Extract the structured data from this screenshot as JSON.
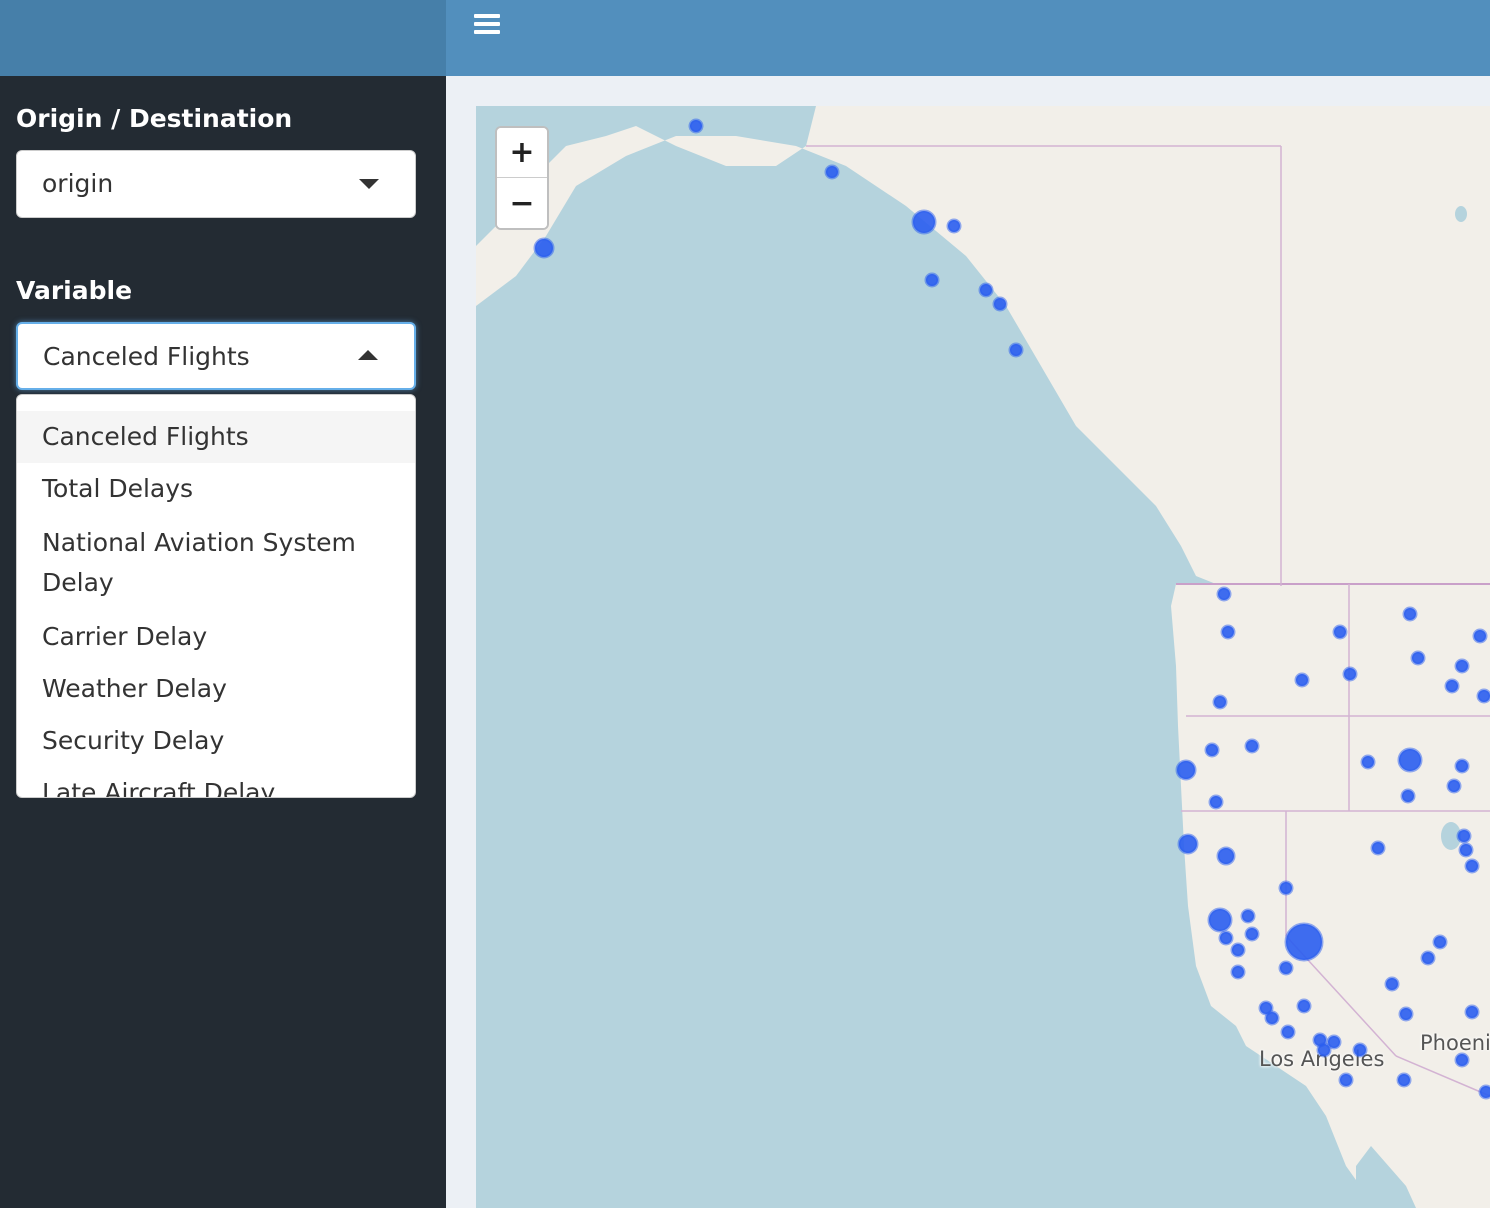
{
  "sidebar": {
    "origin_label": "Origin / Destination",
    "origin_value": "origin",
    "variable_label": "Variable",
    "variable_value": "Canceled Flights",
    "options": [
      "Canceled Flights",
      "Total Delays",
      "National Aviation System Delay",
      "Carrier Delay",
      "Weather Delay",
      "Security Delay",
      "Late Aircraft Delay"
    ]
  },
  "map": {
    "zoom_in": "+",
    "zoom_out": "−",
    "cities": [
      "Los Angeles",
      "Phoenix"
    ],
    "marker_color": "#2a5df0"
  }
}
